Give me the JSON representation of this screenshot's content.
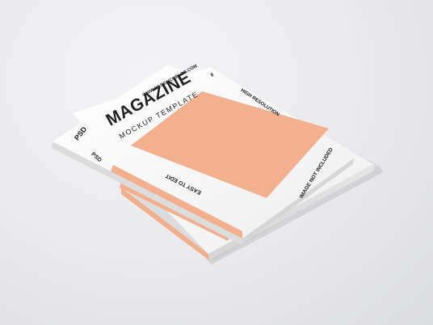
{
  "back_cover": {
    "text": "EASY TO EDIT"
  },
  "front_cover": {
    "website": "WWW.DESIGNCOBLOG.COM",
    "issue": "8",
    "title": "MAGAZINE",
    "subtitle": "MOCKUP TEMPLATE",
    "psd_cover": "PSD",
    "psd_spine": "PSD",
    "resolution": "HIGH RESOLUTION",
    "easy_edit": "EASY TO EDIT",
    "image_note": "IMAGE NOT INCLUDED"
  },
  "colors": {
    "background": "#e9e9ec",
    "paper": "#f7f7f7",
    "accent": "#f2b08f"
  }
}
